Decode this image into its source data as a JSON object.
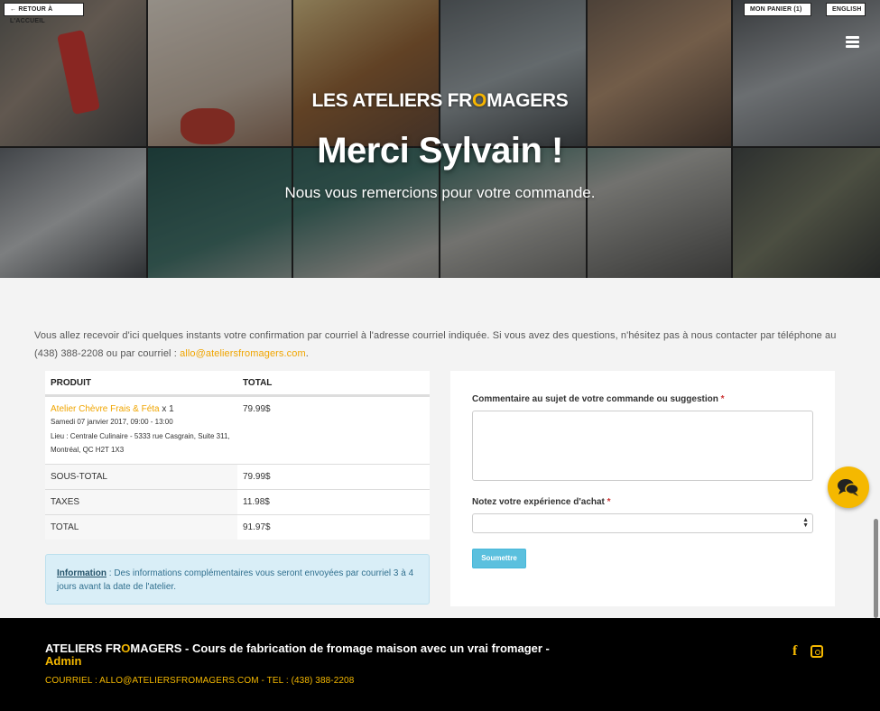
{
  "nav": {
    "back_label": "← RETOUR À L'ACCUEIL",
    "cart_label": "MON PANIER (1)",
    "lang_label": "ENGLISH"
  },
  "hero": {
    "brand_pre": "LES ATELIERS FR",
    "brand_o": "O",
    "brand_post": "MAGERS",
    "title": "Merci Sylvain !",
    "subtitle": "Nous vous remercions pour votre commande."
  },
  "intro": {
    "text": "Vous allez recevoir d'ici quelques instants votre confirmation par courriel à l'adresse courriel indiquée. Si vous avez des questions, n'hésitez pas à nous contacter par téléphone au (438) 388-2208 ou par courriel : ",
    "email": "allo@ateliersfromagers.com",
    "end": "."
  },
  "order": {
    "col_product": "PRODUIT",
    "col_total": "TOTAL",
    "item": {
      "name": "Atelier Chèvre Frais & Féta",
      "qty": " x 1",
      "date": "Samedi 07 janvier 2017, 09:00 - 13:00",
      "location": "Lieu : Centrale Culinaire - 5333 rue Casgrain, Suite 311, Montréal, QC H2T 1X3",
      "price": "79.99$"
    },
    "subtotal_label": "SOUS-TOTAL",
    "subtotal": "79.99$",
    "taxes_label": "TAXES",
    "taxes": "11.98$",
    "total_label": "TOTAL",
    "total": "91.97$"
  },
  "info": {
    "label": "Information",
    "text": " : Des informations complémentaires vous seront envoyées par courriel 3 à 4 jours avant la date de l'atelier."
  },
  "form": {
    "comment_label": "Commentaire au sujet de votre commande ou suggestion",
    "rating_label": "Notez votre expérience d'achat",
    "required_mark": "*",
    "rating_value": "",
    "submit_label": "Soumettre"
  },
  "footer": {
    "title_pre": "ATELIERS FR",
    "title_o": "O",
    "title_post": "MAGERS - Cours de fabrication de fromage maison avec un vrai fromager -",
    "admin": "Admin",
    "contact": "COURRIEL : ALLO@ATELIERSFROMAGERS.COM - TEL : (438) 388-2208",
    "icons": [
      "facebook-icon",
      "instagram-icon"
    ]
  },
  "colors": {
    "accent": "#f5b800",
    "link": "#f0a500",
    "info_bg": "#d9eef7",
    "submit": "#5bc0de"
  }
}
